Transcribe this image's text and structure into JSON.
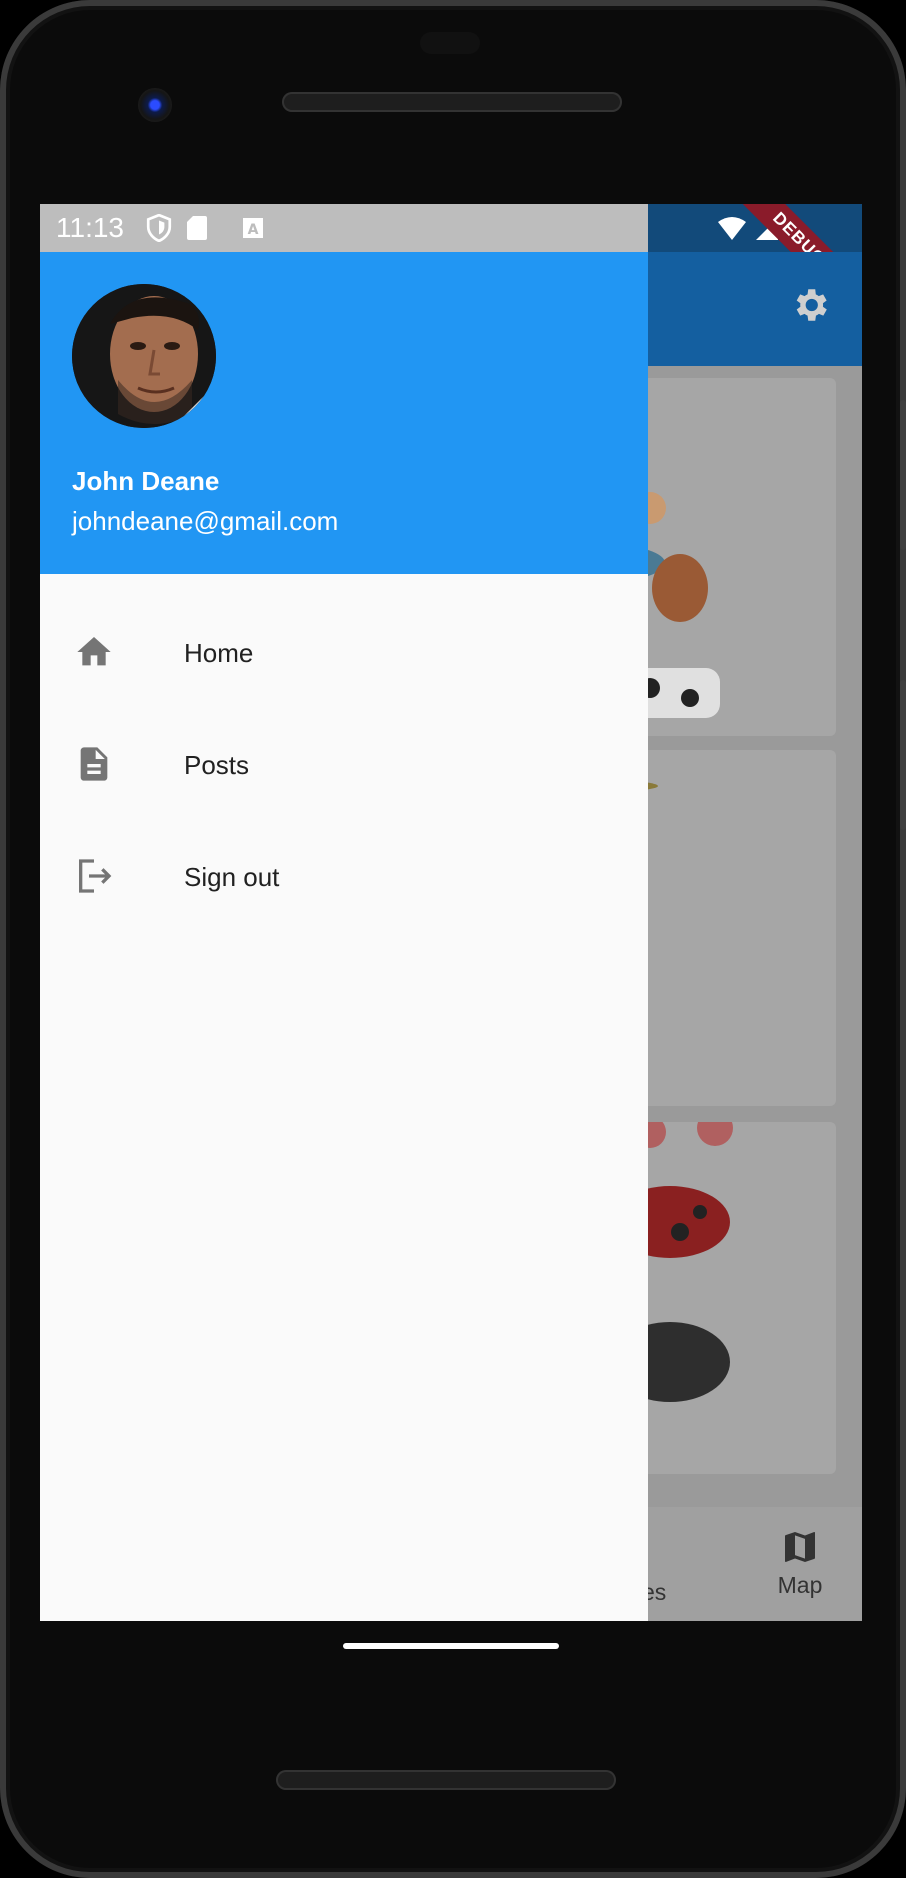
{
  "status_bar": {
    "time": "11:13",
    "icons": [
      "shield-icon",
      "sd-card-icon",
      "keyboard-a-icon",
      "wifi-icon",
      "cellular-signal-icon"
    ]
  },
  "debug_banner": "DEBUG",
  "drawer": {
    "user": {
      "name": "John Deane",
      "email": "johndeane@gmail.com"
    },
    "items": [
      {
        "label": "Home",
        "icon": "home-icon"
      },
      {
        "label": "Posts",
        "icon": "document-icon"
      },
      {
        "label": "Sign out",
        "icon": "sign-out-icon"
      }
    ]
  },
  "background_app": {
    "bottom_nav": {
      "partial_label": "es",
      "map_label": "Map"
    }
  },
  "colors": {
    "drawer_header": "#2196f3",
    "app_bar": "#145fa0",
    "debug_banner": "#8a1b2a"
  }
}
